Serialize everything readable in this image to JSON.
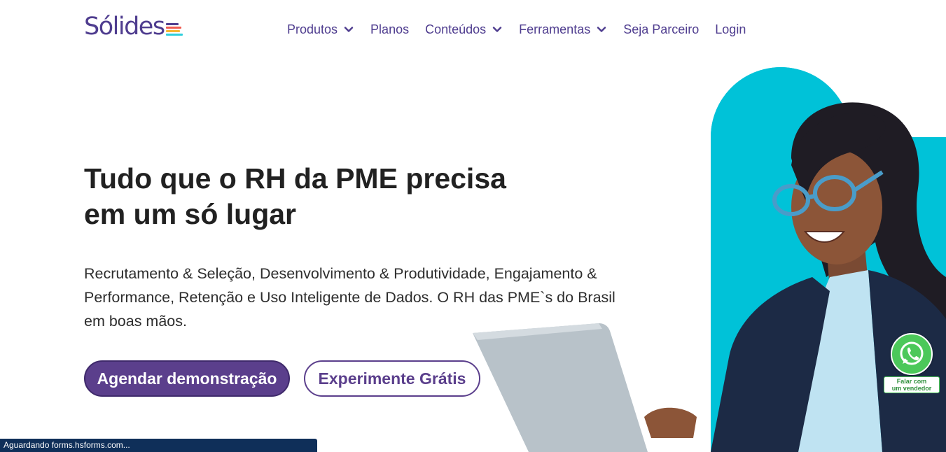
{
  "header": {
    "logo_text": "Sólides",
    "logo_bar_colors": [
      "#4f3d8f",
      "#f05a4f",
      "#f7b733",
      "#2ecfdc"
    ],
    "nav": [
      {
        "label": "Produtos",
        "has_dropdown": true
      },
      {
        "label": "Planos",
        "has_dropdown": false
      },
      {
        "label": "Conteúdos",
        "has_dropdown": true
      },
      {
        "label": "Ferramentas",
        "has_dropdown": true
      },
      {
        "label": "Seja Parceiro",
        "has_dropdown": false
      },
      {
        "label": "Login",
        "has_dropdown": false
      }
    ]
  },
  "hero": {
    "headline_line1": "Tudo que o RH da PME precisa",
    "headline_line2": "em um só lugar",
    "subtitle": "Recrutamento & Seleção, Desenvolvimento & Produtividade, Engajamento & Performance, Retenção e Uso Inteligente de Dados. O RH das PME`s do Brasil em boas mãos.",
    "primary_button": "Agendar demonstração",
    "secondary_button": "Experimente Grátis"
  },
  "whatsapp": {
    "icon": "whatsapp-icon",
    "label_line1": "Falar com",
    "label_line2": "um vendedor"
  },
  "status_bar": {
    "text": "Aguardando forms.hsforms.com..."
  },
  "colors": {
    "brand_purple": "#4f3d8f",
    "button_purple": "#5b3f8c",
    "hero_cyan": "#00c2d8",
    "whatsapp_green": "#4cc85a",
    "status_bar_bg": "#0f2f59"
  }
}
